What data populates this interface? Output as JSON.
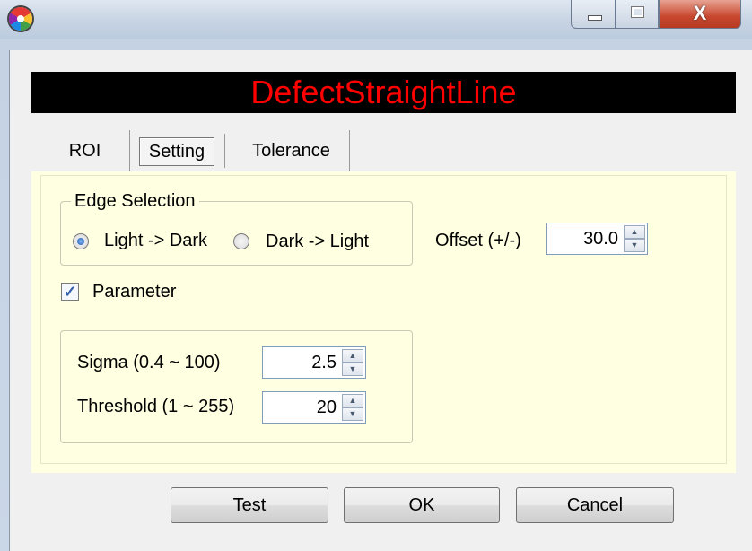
{
  "window": {
    "close_glyph": "X"
  },
  "banner": {
    "title": "DefectStraightLine",
    "color": "#ff0000"
  },
  "tabs": [
    {
      "label": "ROI",
      "selected": false
    },
    {
      "label": "Setting",
      "selected": true
    },
    {
      "label": "Tolerance",
      "selected": false
    }
  ],
  "edge_selection": {
    "legend": "Edge Selection",
    "options": [
      {
        "label": "Light -> Dark",
        "selected": true
      },
      {
        "label": "Dark -> Light",
        "selected": false
      }
    ]
  },
  "offset": {
    "label": "Offset (+/-)",
    "value": "30.0"
  },
  "parameter": {
    "label": "Parameter",
    "checked": true
  },
  "sigma": {
    "label": "Sigma (0.4 ~ 100)",
    "value": "2.5"
  },
  "threshold": {
    "label": "Threshold (1 ~ 255)",
    "value": "20"
  },
  "buttons": {
    "test": "Test",
    "ok": "OK",
    "cancel": "Cancel"
  },
  "icons": {
    "app": "app-icon",
    "spin_up": "spin-up-arrow-icon",
    "spin_down": "spin-down-arrow-icon",
    "check": "checkmark-icon"
  },
  "colors": {
    "panel_background": "#ffffe1",
    "banner_background": "#000000"
  }
}
